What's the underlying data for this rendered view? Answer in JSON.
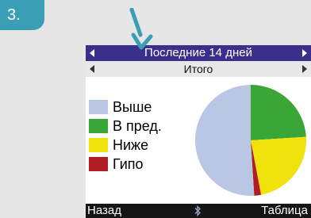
{
  "step": {
    "number": "3."
  },
  "screen": {
    "header": {
      "title": "Последние 14 дней"
    },
    "subheader": {
      "title": "Итого"
    },
    "legend": [
      {
        "label": "Выше",
        "color": "#b9c6e4"
      },
      {
        "label": "В пред.",
        "color": "#3aa635"
      },
      {
        "label": "Ниже",
        "color": "#f0e20c"
      },
      {
        "label": "Гипо",
        "color": "#b01e24"
      }
    ],
    "footer": {
      "left_label": "Назад",
      "right_label": "Таблица"
    }
  },
  "chart_data": {
    "type": "pie",
    "categories": [
      "Выше",
      "В пред.",
      "Ниже",
      "Гипо"
    ],
    "values": [
      51,
      24,
      23,
      2
    ],
    "colors": [
      "#b9c6e4",
      "#3aa635",
      "#f0e20c",
      "#b01e24"
    ]
  },
  "colors": {
    "badge": "#3a9fb4",
    "header_bg": "#3b2f8c",
    "footer_bg": "#151515",
    "pointer_arrow": "#3a9fb4"
  },
  "icons": {
    "pointer": "down-arrow-pointer-icon",
    "footer_middle": "bluetooth-icon"
  }
}
